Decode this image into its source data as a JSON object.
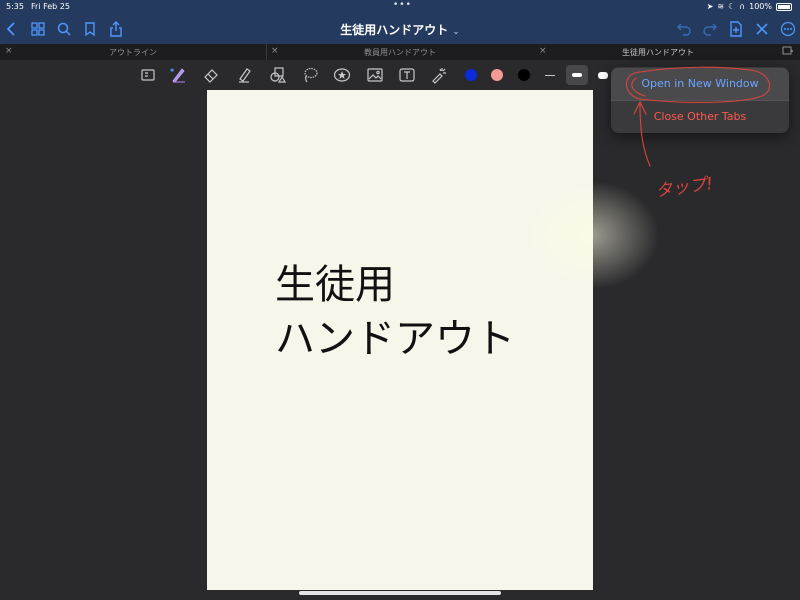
{
  "status": {
    "time": "5:35",
    "date": "Fri Feb 25",
    "battery": "100%"
  },
  "navbar": {
    "title": "生徒用ハンドアウト",
    "title_chevron": "⌄",
    "accent_color": "#4f97ff"
  },
  "tabs": [
    {
      "label": "アウトライン",
      "close": "×"
    },
    {
      "label": "教員用ハンドアウト",
      "close": "×"
    },
    {
      "label": "生徒用ハンドアウト",
      "close": "×"
    }
  ],
  "toolbar": {
    "colors": [
      "#0a2bd9",
      "#f29a96",
      "#000000"
    ]
  },
  "page": {
    "line1": "生徒用",
    "line2": "ハンドアウト"
  },
  "menu": {
    "open_new_window": "Open in New Window",
    "close_other_tabs": "Close Other Tabs"
  },
  "annotation": {
    "text": "タップ!",
    "color": "#d9453c"
  }
}
